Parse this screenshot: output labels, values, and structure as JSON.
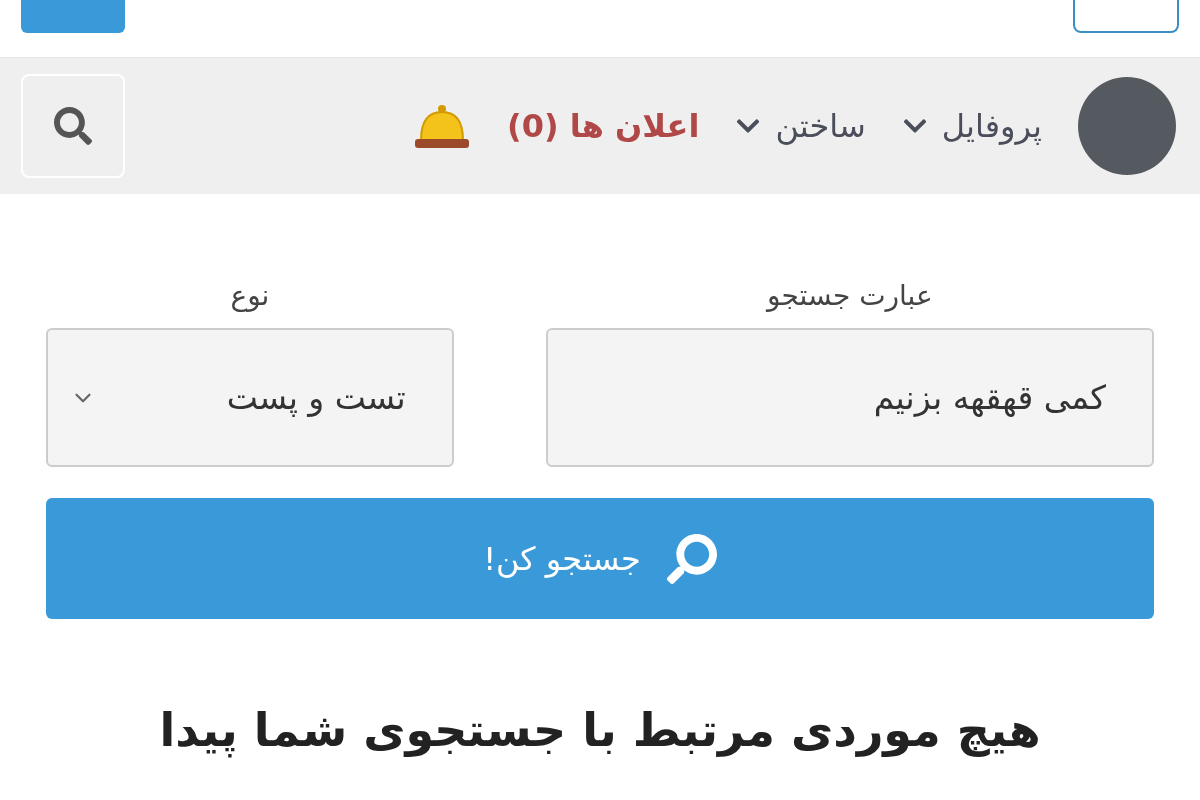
{
  "nav": {
    "items": [
      {
        "kind": "menu",
        "label": "پروفایل"
      },
      {
        "kind": "menu",
        "label": "ساختن"
      },
      {
        "kind": "alert",
        "label": "اعلان ها (0)"
      }
    ]
  },
  "form": {
    "query": {
      "label": "عبارت جستجو",
      "value": "کمی قهقهه بزنیم"
    },
    "type": {
      "label": "نوع",
      "value": "تست و پست"
    },
    "submit": "جستجو کن!"
  },
  "result": {
    "message": "هیچ موردی مرتبط با جستجوی شما پیدا"
  }
}
